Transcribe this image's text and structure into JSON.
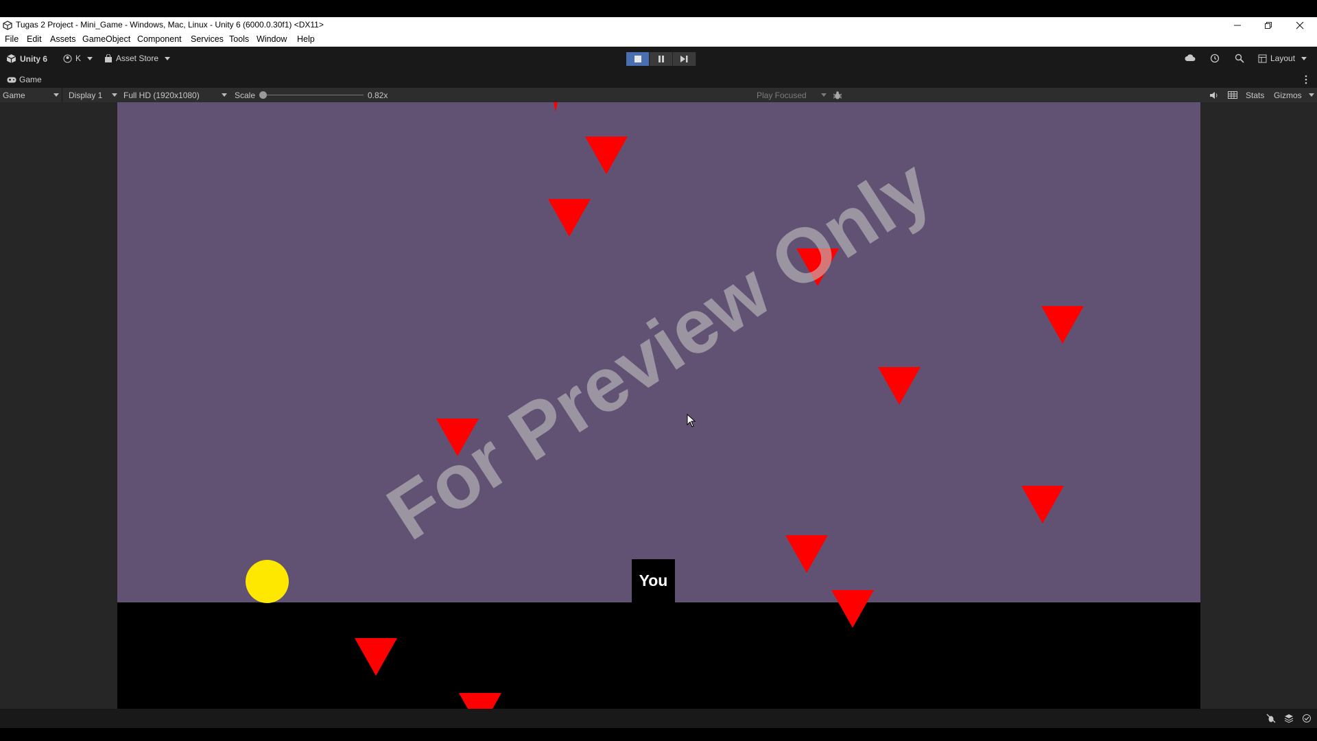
{
  "window": {
    "title": "Tugas 2 Project - Mini_Game - Windows, Mac, Linux - Unity 6 (6000.0.30f1) <DX11>"
  },
  "menu": [
    "File",
    "Edit",
    "Assets",
    "GameObject",
    "Component",
    "Services",
    "Tools",
    "Window",
    "Help"
  ],
  "toolbar": {
    "unity_label": "Unity 6",
    "account_label": "K",
    "asset_store_label": "Asset Store",
    "layout_label": "Layout"
  },
  "play_controls": {
    "playing": true,
    "paused": false
  },
  "tab": {
    "label": "Game"
  },
  "game_toolbar": {
    "view_mode": "Game",
    "display": "Display 1",
    "resolution": "Full HD (1920x1080)",
    "scale_label": "Scale",
    "scale_value": "0.82x",
    "scale_slider_fraction": 0.0,
    "play_mode": "Play Focused",
    "stats_label": "Stats",
    "gizmos_label": "Gizmos"
  },
  "game": {
    "player_label": "You",
    "watermark": "For Preview Only",
    "colors": {
      "background": "#615274",
      "ground": "#000000",
      "obstacle": "#ff0000",
      "coin": "#ffe800",
      "player": "#000000"
    }
  },
  "colors": {
    "editor_dark": "#191919",
    "play_active": "#4a6fb0"
  }
}
